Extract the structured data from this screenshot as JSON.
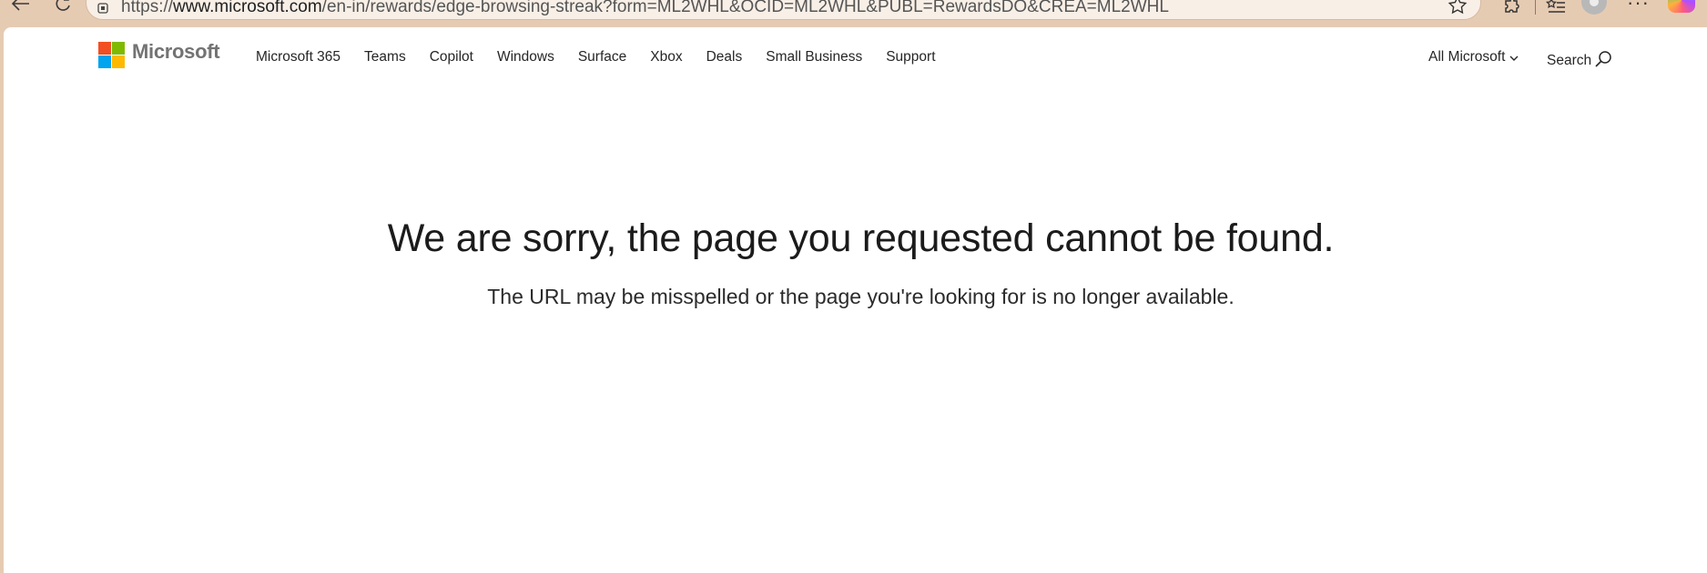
{
  "browser": {
    "url_prefix": "https://",
    "url_host": "www.microsoft.com",
    "url_path": "/en-in/rewards/edge-browsing-streak?form=ML2WHL&OCID=ML2WHL&PUBL=RewardsDO&CREA=ML2WHL",
    "icons": {
      "back": "back-arrow-icon",
      "refresh": "refresh-icon",
      "site_info": "site-info-icon",
      "favorite": "star-icon",
      "extensions": "puzzle-icon",
      "favorites_list": "favorites-list-icon",
      "profile": "profile-avatar",
      "more": "more-icon",
      "copilot": "copilot-icon"
    }
  },
  "header": {
    "brand": "Microsoft",
    "nav": [
      {
        "label": "Microsoft 365"
      },
      {
        "label": "Teams"
      },
      {
        "label": "Copilot"
      },
      {
        "label": "Windows"
      },
      {
        "label": "Surface"
      },
      {
        "label": "Xbox"
      },
      {
        "label": "Deals"
      },
      {
        "label": "Small Business"
      },
      {
        "label": "Support"
      }
    ],
    "all_microsoft": "All Microsoft",
    "search": "Search"
  },
  "error": {
    "heading": "We are sorry, the page you requested cannot be found.",
    "subtext": "The URL may be misspelled or the page you're looking for is no longer available."
  },
  "colors": {
    "chrome_bg": "#e6cbb3",
    "page_bg": "#ffffff",
    "logo_red": "#f25022",
    "logo_green": "#7fba00",
    "logo_blue": "#00a4ef",
    "logo_yellow": "#ffb900",
    "wordmark": "#737373"
  }
}
